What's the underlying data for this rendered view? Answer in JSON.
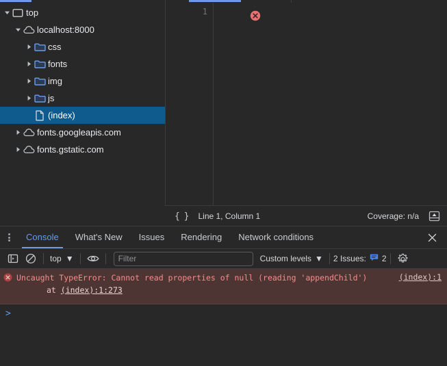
{
  "window": {
    "theme": "dark",
    "accent": "#6a9ae8",
    "error_bg": "#4d3534",
    "selection_bg": "#0f5b8e"
  },
  "navigator": {
    "name": "page-tree",
    "items": [
      {
        "label": "top",
        "icon": "frame-icon",
        "depth": 0,
        "expanded": true,
        "selected": false
      },
      {
        "label": "localhost:8000",
        "icon": "cloud-icon",
        "depth": 1,
        "expanded": true,
        "selected": false
      },
      {
        "label": "css",
        "icon": "folder-icon",
        "depth": 2,
        "expanded": false,
        "selected": false
      },
      {
        "label": "fonts",
        "icon": "folder-icon",
        "depth": 2,
        "expanded": false,
        "selected": false
      },
      {
        "label": "img",
        "icon": "folder-icon",
        "depth": 2,
        "expanded": false,
        "selected": false
      },
      {
        "label": "js",
        "icon": "folder-icon",
        "depth": 2,
        "expanded": false,
        "selected": false
      },
      {
        "label": "(index)",
        "icon": "file-icon",
        "depth": 2,
        "expanded": null,
        "selected": true
      },
      {
        "label": "fonts.googleapis.com",
        "icon": "cloud-icon",
        "depth": 1,
        "expanded": false,
        "selected": false
      },
      {
        "label": "fonts.gstatic.com",
        "icon": "cloud-icon",
        "depth": 1,
        "expanded": false,
        "selected": false
      }
    ]
  },
  "editor": {
    "line_number": "1",
    "error_marker": "error-circle-icon",
    "status": {
      "format_icon": "curly-braces-icon",
      "position": "Line 1, Column 1",
      "coverage": "Coverage: n/a",
      "popout_icon": "show-drawer-icon"
    }
  },
  "drawer": {
    "menu_icon": "kebab-menu-icon",
    "tabs": [
      {
        "label": "Console",
        "active": true
      },
      {
        "label": "What's New",
        "active": false
      },
      {
        "label": "Issues",
        "active": false
      },
      {
        "label": "Rendering",
        "active": false
      },
      {
        "label": "Network conditions",
        "active": false
      }
    ],
    "close_label": "✕",
    "toolbar": {
      "sidebar_icon": "console-sidebar-icon",
      "clear_icon": "clear-console-icon",
      "context": "top",
      "context_caret": "▼",
      "eye_icon": "live-expression-icon",
      "filter_placeholder": "Filter",
      "filter_value": "",
      "levels_label": "Custom levels",
      "levels_caret": "▼",
      "issues_label": "2 Issues:",
      "issues_icon": "issues-badge-icon",
      "issues_count": "2",
      "settings_icon": "gear-icon"
    },
    "console": {
      "error": {
        "icon": "error-circle-icon",
        "text": "Uncaught TypeError: Cannot read properties of null (reading 'appendChild')",
        "stack_prefix": "    at ",
        "stack_link": "(index):1:273",
        "source_link": "(index):1"
      },
      "prompt_symbol": ">"
    }
  }
}
